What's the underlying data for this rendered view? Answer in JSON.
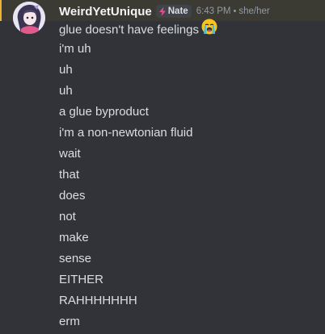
{
  "message": {
    "username": "WeirdYetUnique",
    "role_tag": "Nate",
    "role_tag_icon": "lightning-icon",
    "role_tag_color": "#e84c8b",
    "timestamp": "6:43 PM",
    "pronoun_separator": "•",
    "pronouns": "she/her",
    "highlight_color": "#f0b232",
    "lines": [
      {
        "text": "glue doesn't have feelings",
        "emoji": "loudly-crying-face-emoji"
      },
      {
        "text": "i'm uh"
      },
      {
        "text": "uh"
      },
      {
        "text": "uh"
      },
      {
        "text": "a glue byproduct"
      },
      {
        "text": "i'm a non-newtonian fluid"
      },
      {
        "text": "wait"
      },
      {
        "text": "that"
      },
      {
        "text": "does"
      },
      {
        "text": "not"
      },
      {
        "text": "make"
      },
      {
        "text": "sense"
      },
      {
        "text": "EITHER"
      },
      {
        "text": "RAHHHHHHH"
      },
      {
        "text": "erm"
      }
    ]
  }
}
